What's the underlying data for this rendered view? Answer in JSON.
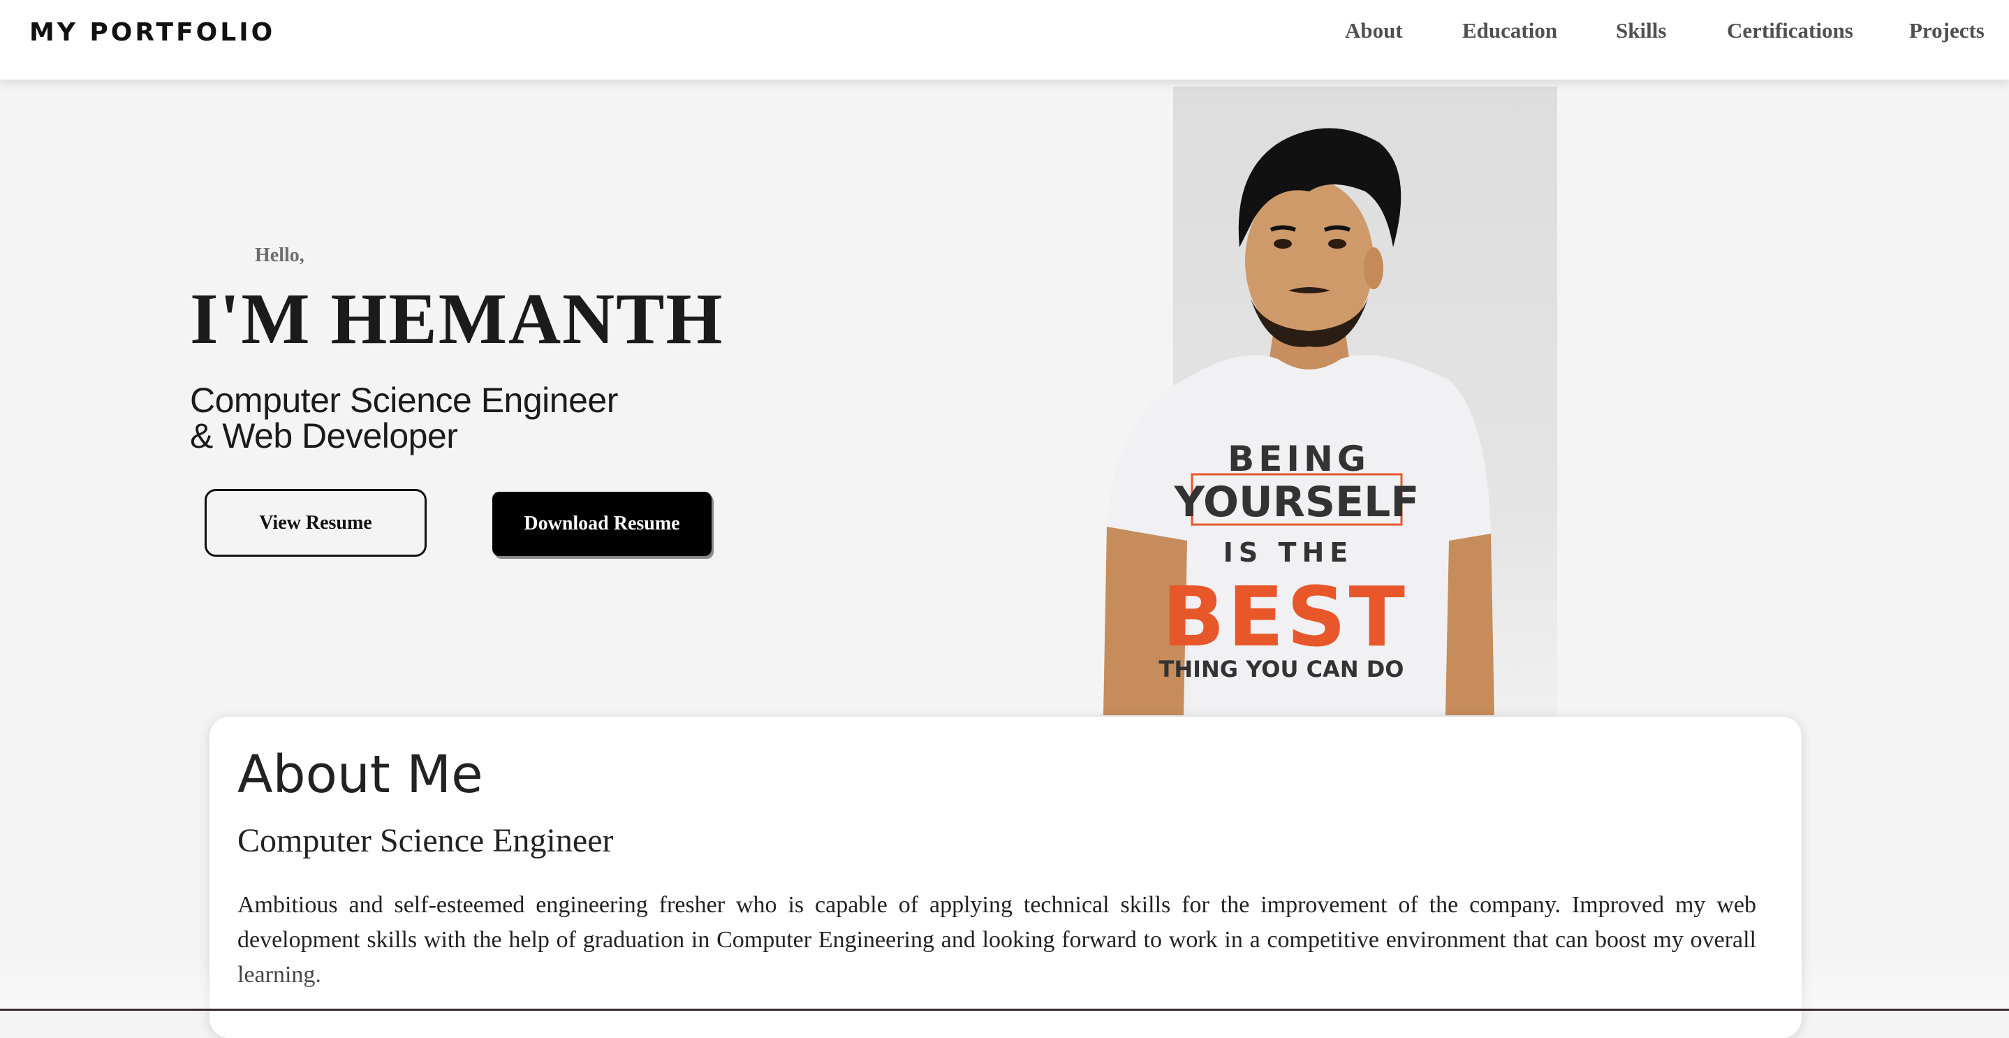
{
  "navbar": {
    "brand": "MY PORTFOLIO",
    "links": [
      "About",
      "Education",
      "Skills",
      "Certifications",
      "Projects"
    ]
  },
  "hero": {
    "greeting": "Hello,",
    "name": "I'M HEMANTH",
    "role_line1": "Computer Science Engineer",
    "role_line2": "& Web Developer",
    "view_resume": "View Resume",
    "download_resume": "Download Resume",
    "portrait_icon": "portrait-photo",
    "shirt_text": [
      "BEING",
      "YOURSELF",
      "IS THE",
      "BEST",
      "THING YOU CAN DO"
    ]
  },
  "about": {
    "title": "About Me",
    "subtitle": "Computer Science Engineer",
    "body": "Ambitious and self-esteemed engineering fresher who is capable of applying technical skills for the improvement of the company. Improved my web development skills with the help of graduation in Computer Engineering and looking forward to work in a competitive environment that can boost my overall learning."
  },
  "colors": {
    "page_bg": "#f4f4f4",
    "nav_bg": "#ffffff",
    "text_dark": "#1b1b1b",
    "button_dark": "#000000",
    "shirt_accent": "#e8572a"
  }
}
